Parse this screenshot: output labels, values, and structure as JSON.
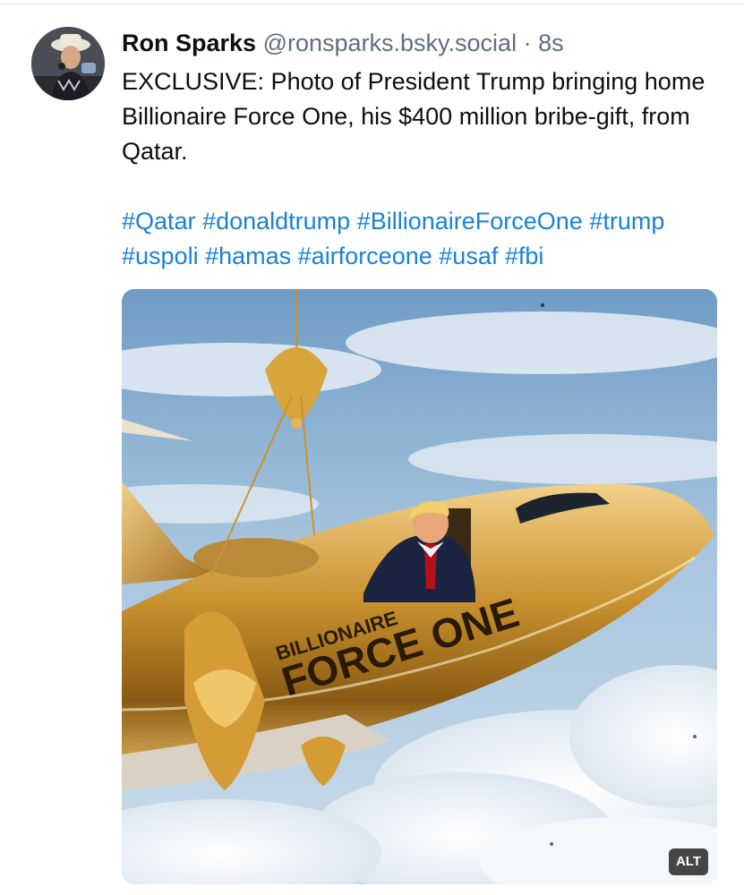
{
  "post": {
    "author_name": "Ron Sparks",
    "handle": "@ronsparks.bsky.social",
    "separator": "·",
    "time": "8s",
    "text": "EXCLUSIVE: Photo of President Trump bringing home Billionaire Force One, his $400 million bribe-gift, from Qatar.",
    "hashtags": [
      "#Qatar",
      "#donaldtrump",
      "#BillionaireForceOne",
      "#trump",
      "#uspoli",
      "#hamas",
      "#airforceone",
      "#usaf",
      "#fbi"
    ]
  },
  "media": {
    "plane_text_line1": "BILLIONAIRE",
    "plane_text_line2": "FORCE ONE",
    "alt_label": "ALT"
  },
  "colors": {
    "hashtag": "#1a82d6",
    "handle": "#5f6f80",
    "gold": "#c9932e"
  }
}
